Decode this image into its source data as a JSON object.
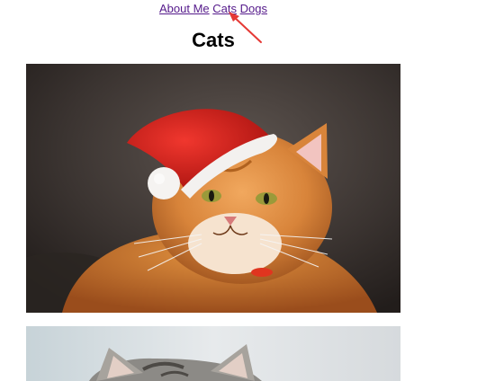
{
  "nav": {
    "links": [
      "About Me",
      "Cats",
      "Dogs"
    ]
  },
  "page": {
    "title": "Cats"
  },
  "images": [
    {
      "subject": "orange-tabby-cat-in-santa-hat"
    },
    {
      "subject": "tabby-cat-ears"
    }
  ],
  "colors": {
    "link": "#551a8b",
    "annotation_arrow": "#e53935",
    "hat_red": "#d41e1e"
  }
}
